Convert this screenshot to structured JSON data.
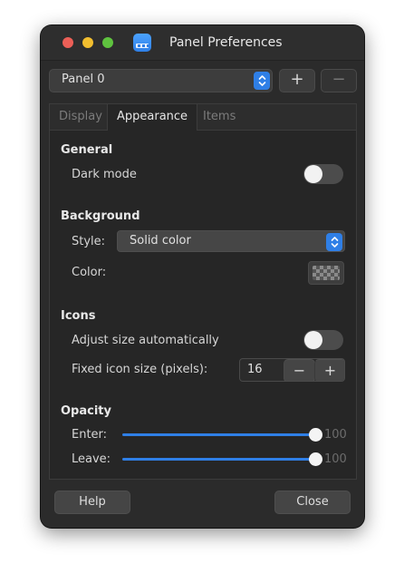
{
  "window": {
    "title": "Panel Preferences"
  },
  "panel_selector": {
    "value": "Panel 0",
    "add_label": "+",
    "remove_label": "−"
  },
  "tabs": [
    {
      "label": "Display",
      "state": "inactive"
    },
    {
      "label": "Appearance",
      "state": "active"
    },
    {
      "label": "Items",
      "state": "disabled"
    }
  ],
  "general": {
    "heading": "General",
    "dark_mode_label": "Dark mode",
    "dark_mode_on": false
  },
  "background": {
    "heading": "Background",
    "style_label": "Style:",
    "style_value": "Solid color",
    "color_label": "Color:"
  },
  "icons": {
    "heading": "Icons",
    "adjust_label": "Adjust size automatically",
    "adjust_on": false,
    "fixed_label": "Fixed icon size (pixels):",
    "fixed_value": "16",
    "minus": "−",
    "plus": "+"
  },
  "opacity": {
    "heading": "Opacity",
    "enter_label": "Enter:",
    "enter_value": "100",
    "leave_label": "Leave:",
    "leave_value": "100"
  },
  "footer": {
    "help_label": "Help",
    "close_label": "Close"
  },
  "colors": {
    "accent": "#2f7fe6",
    "window_bg": "#2b2b2b"
  }
}
